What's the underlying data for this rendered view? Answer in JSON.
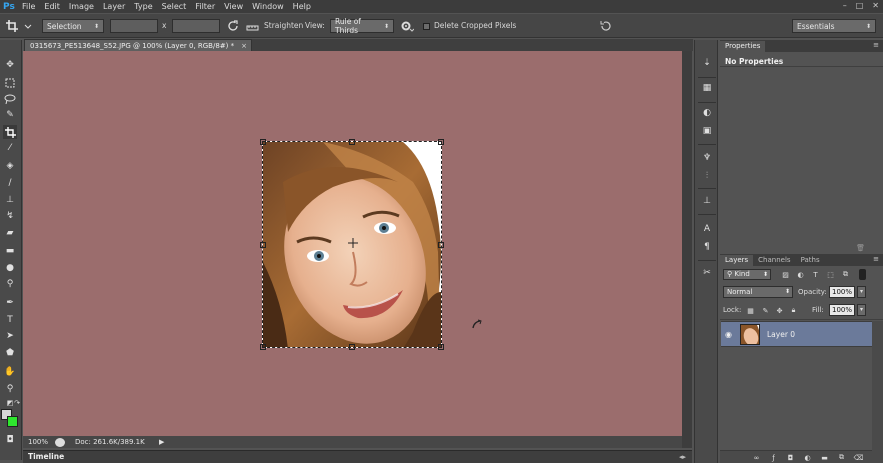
{
  "menu": {
    "logo": "Ps",
    "items": [
      "File",
      "Edit",
      "Image",
      "Layer",
      "Type",
      "Select",
      "Filter",
      "View",
      "Window",
      "Help"
    ],
    "window_controls": [
      "–",
      "□",
      "✕"
    ]
  },
  "options": {
    "ratio_value": "Selection",
    "x_label": "x",
    "straighten_label": "Straighten",
    "view_label": "View:",
    "view_value": "Rule of Thirds",
    "delete_cropped_label": "Delete Cropped Pixels",
    "workspace": "Essentials"
  },
  "document": {
    "tab_title": "0315673_PE513648_S52.JPG @ 100% (Layer 0, RGB/8#) *",
    "close": "×",
    "zoom": "100%",
    "doc_info": "Doc: 261.6K/389.1K"
  },
  "timeline": {
    "label": "Timeline"
  },
  "properties": {
    "tab": "Properties",
    "content": "No Properties"
  },
  "layers": {
    "tabs": [
      "Layers",
      "Channels",
      "Paths"
    ],
    "kind_filter": "Kind",
    "blend_mode": "Normal",
    "opacity_label": "Opacity:",
    "opacity_value": "100%",
    "lock_label": "Lock:",
    "fill_label": "Fill:",
    "fill_value": "100%",
    "layer_name": "Layer 0"
  },
  "colors": {
    "canvas_bg": "#9b6d6d",
    "foreground": "#d6d6d6",
    "background": "#2ee62e",
    "selected_layer": "#6b7a9a"
  }
}
